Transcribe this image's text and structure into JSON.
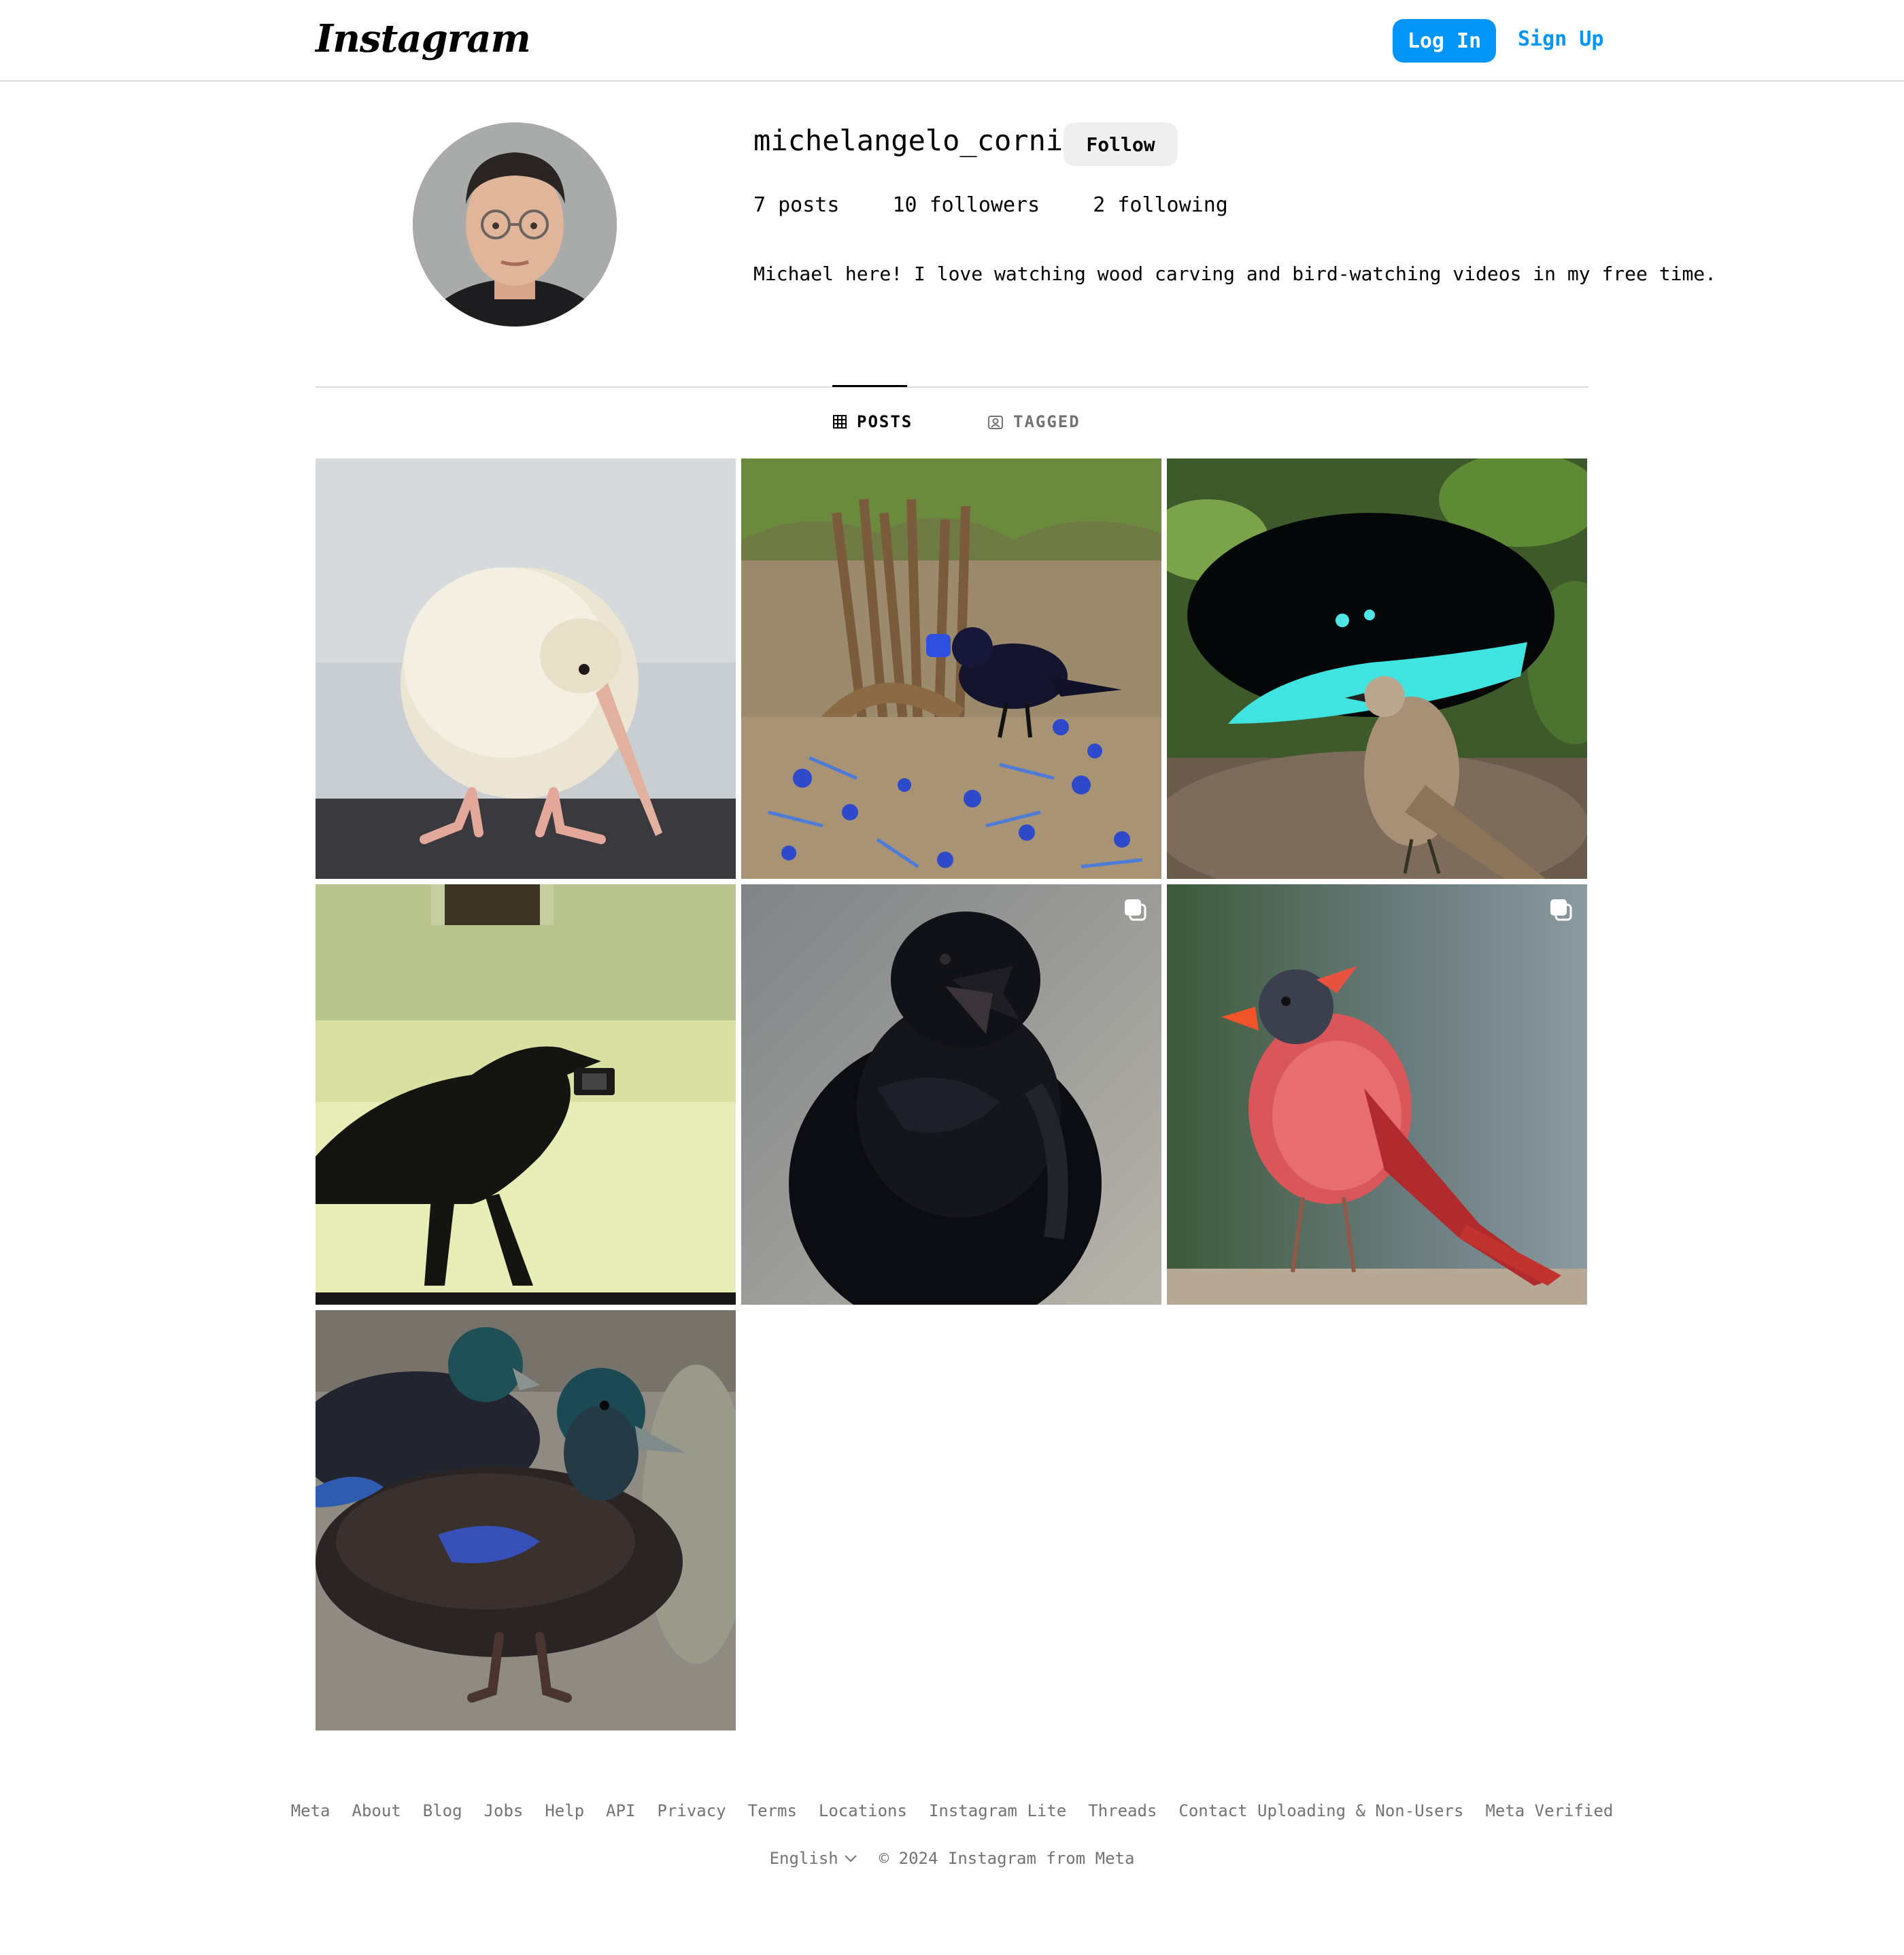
{
  "header": {
    "logo": "Instagram",
    "login_label": "Log In",
    "signup_label": "Sign Up"
  },
  "profile": {
    "username": "michelangelo_corning",
    "follow_label": "Follow",
    "posts": "7 posts",
    "followers": "10 followers",
    "following": "2 following",
    "bio": "Michael here! I love watching wood carving and bird-watching videos in my free time."
  },
  "tabs": {
    "posts": "POSTS",
    "tagged": "TAGGED"
  },
  "posts": [
    {
      "subject": "white kiwi chick",
      "multi": false
    },
    {
      "subject": "satin bowerbird with blue items",
      "multi": false
    },
    {
      "subject": "bird of paradise display",
      "multi": false
    },
    {
      "subject": "crow silhouette holding camera",
      "multi": false
    },
    {
      "subject": "raven calling",
      "multi": true
    },
    {
      "subject": "molting cardinal",
      "multi": true
    },
    {
      "subject": "black ducks",
      "multi": false
    }
  ],
  "footer": {
    "links": [
      "Meta",
      "About",
      "Blog",
      "Jobs",
      "Help",
      "API",
      "Privacy",
      "Terms",
      "Locations",
      "Instagram Lite",
      "Threads",
      "Contact Uploading & Non-Users",
      "Meta Verified"
    ],
    "language": "English",
    "copyright": "© 2024 Instagram from Meta"
  },
  "colors": {
    "accent": "#0095f6",
    "border": "#dbdbdb",
    "muted": "#737373",
    "button_gray": "#efefef"
  }
}
